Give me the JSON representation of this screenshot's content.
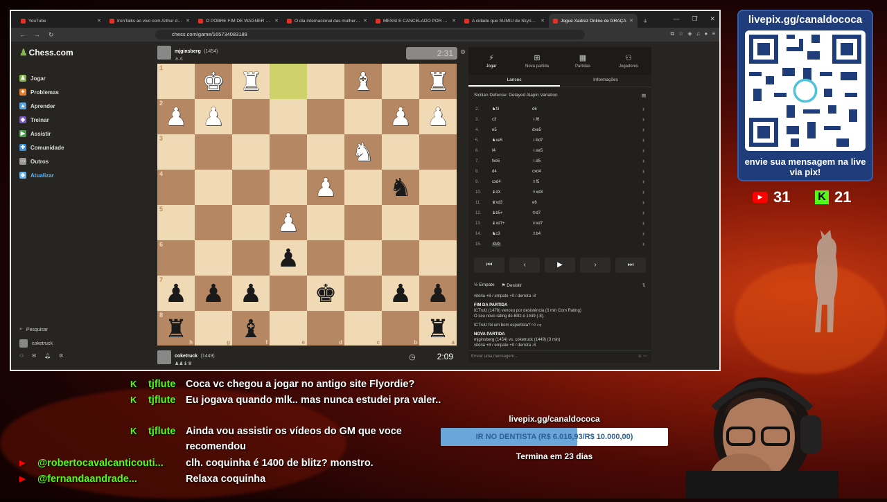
{
  "browser": {
    "tabs": [
      {
        "label": "YouTube",
        "active": false
      },
      {
        "label": "IronTalks ao vivo com Arthur do Val",
        "active": false
      },
      {
        "label": "O POBRE FIM DE WAGNER MOURA",
        "active": false
      },
      {
        "label": "O dia internacional das mulheres é u",
        "active": false
      },
      {
        "label": "MESSI É CANCELADO POR ESQUERI",
        "active": false
      },
      {
        "label": "A cidade que SUMIU de Skyrim - Vai",
        "active": false
      },
      {
        "label": "Jogue Xadrez Online de GRAÇA",
        "active": true
      }
    ],
    "url": "chess.com/game/165734083188"
  },
  "sidebar": {
    "logo": "Chess.com",
    "items": [
      {
        "label": "Jogar",
        "color": "#81b64c"
      },
      {
        "label": "Problemas",
        "color": "#e27d2c"
      },
      {
        "label": "Aprender",
        "color": "#5aa4e0"
      },
      {
        "label": "Treinar",
        "color": "#7a59c0"
      },
      {
        "label": "Assistir",
        "color": "#4fa04a"
      },
      {
        "label": "Comunidade",
        "color": "#3a8fd8"
      },
      {
        "label": "Outros",
        "color": "#999999"
      },
      {
        "label": "Atualizar",
        "color": "#5fb3f0"
      }
    ],
    "search": "Pesquisar",
    "user": "coketruck"
  },
  "game": {
    "top_player": {
      "name": "mjginsberg",
      "rating": "(1454)",
      "clock": "2:31"
    },
    "bottom_player": {
      "name": "coketruck",
      "rating": "(1449)",
      "clock": "2:09"
    },
    "board_light": "#f0d9b5",
    "board_dark": "#b58863",
    "highlight": "#cdd26a",
    "ranks": [
      "1",
      "2",
      "3",
      "4",
      "5",
      "6",
      "7",
      "8"
    ],
    "files": [
      "h",
      "g",
      "f",
      "e",
      "d",
      "c",
      "b",
      "a"
    ],
    "position": [
      [
        "",
        "wK",
        "wR",
        "",
        "",
        "wB",
        "",
        "wR"
      ],
      [
        "wP",
        "wP",
        "",
        "",
        "",
        "",
        "wP",
        "wP"
      ],
      [
        "",
        "",
        "",
        "",
        "",
        "wN",
        "",
        ""
      ],
      [
        "",
        "",
        "",
        "",
        "wP",
        "",
        "bN",
        ""
      ],
      [
        "",
        "",
        "",
        "wP",
        "",
        "",
        "",
        ""
      ],
      [
        "",
        "",
        "",
        "bP",
        "",
        "",
        "",
        ""
      ],
      [
        "bP",
        "bP",
        "bP",
        "",
        "bK",
        "",
        "bP",
        "bP"
      ],
      [
        "bR",
        "",
        "bB",
        "",
        "",
        "",
        "",
        "bR"
      ]
    ],
    "highlight_squares": [
      [
        0,
        3
      ]
    ]
  },
  "panel": {
    "tabs": [
      {
        "label": "Jogar",
        "icon": "bolt"
      },
      {
        "label": "Nova partida",
        "icon": "plus"
      },
      {
        "label": "Partidas",
        "icon": "grid"
      },
      {
        "label": "Jogadores",
        "icon": "users"
      }
    ],
    "subtabs": [
      "Lances",
      "Informações"
    ],
    "opening": "Sicilian Defense: Delayed Alapin Variation",
    "moves": [
      {
        "n": "2.",
        "w": "♞f3",
        "b": "d6"
      },
      {
        "n": "3.",
        "w": "c3",
        "b": "♘f6"
      },
      {
        "n": "4.",
        "w": "e5",
        "b": "dxe5"
      },
      {
        "n": "5.",
        "w": "♞xe5",
        "b": "♘bd7"
      },
      {
        "n": "6.",
        "w": "f4",
        "b": "♘xe5"
      },
      {
        "n": "7.",
        "w": "fxe5",
        "b": "♘d5"
      },
      {
        "n": "8.",
        "w": "d4",
        "b": "cxd4"
      },
      {
        "n": "9.",
        "w": "cxd4",
        "b": "♗f5"
      },
      {
        "n": "10.",
        "w": "♝d3",
        "b": "♗xd3"
      },
      {
        "n": "11.",
        "w": "♛xd3",
        "b": "e6"
      },
      {
        "n": "12.",
        "w": "♝b5+",
        "b": "♔d7"
      },
      {
        "n": "13.",
        "w": "♝xd7+",
        "b": "♕xd7"
      },
      {
        "n": "14.",
        "w": "♞c3",
        "b": "♗b4"
      },
      {
        "n": "15.",
        "w": "0-0",
        "b": ""
      }
    ],
    "draw": "Empate",
    "resign": "Desistir",
    "log": {
      "l1": "vitória +8 / empate +0 / derrota -8",
      "h1": "FIM DA PARTIDA",
      "l2": "ICTruU (1478) venceu por desistência (3 min Com Rating)",
      "l3": "O seu novo rating de Blitz é 1449 (-8).",
      "l4": "ICTruU foi um bom esportista?",
      "h2": "NOVA PARTIDA",
      "l5": "mjginsberg (1454) vs. coketruck (1449) (3 min)",
      "l6": "vitória +8 / empate +0 / derrota -8"
    },
    "chat_placeholder": "Enviar uma mensagem..."
  },
  "livepix": {
    "title": "livepix.gg/canaldococa",
    "bottom": "envie sua mensagem na live via pix!",
    "yt_count": "31",
    "kick_count": "21"
  },
  "chat": [
    {
      "platform": "kick",
      "user": "tjflute",
      "msg": "Coca vc chegou a jogar no antigo site Flyordie?"
    },
    {
      "platform": "kick",
      "user": "tjflute",
      "msg": "Eu jogava quando mlk.. mas nunca estudei pra valer.."
    },
    {
      "platform": "kick",
      "user": "tjflute",
      "msg": "Ainda vou assistir os vídeos do GM que voce recomendou"
    },
    {
      "platform": "youtube",
      "user": "@robertocavalcanticouti...",
      "msg": "clh. coquinha é 1400 de blitz? monstro."
    },
    {
      "platform": "youtube",
      "user": "@fernandaandrade...",
      "msg": "Relaxa coquinha"
    }
  ],
  "goal": {
    "title": "livepix.gg/canaldococa",
    "label": "IR NO DENTISTA (R$ 6.016,93/R$ 10.000,00)",
    "progress": 0.6017,
    "days": "Termina em 23 dias"
  }
}
